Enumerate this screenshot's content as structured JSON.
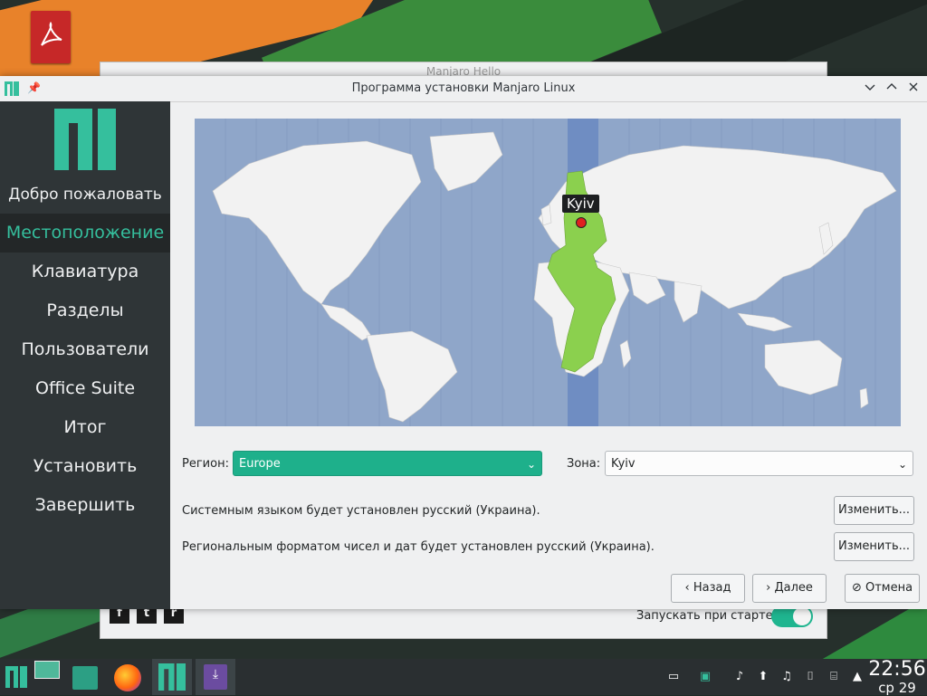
{
  "background_window": {
    "title": "Manjaro Hello",
    "autostart_label": "Запускать при старте",
    "social": [
      "f",
      "t",
      "r"
    ]
  },
  "window": {
    "title": "Программа установки Manjaro Linux"
  },
  "sidebar": {
    "items": [
      {
        "label": "Добро пожаловать"
      },
      {
        "label": "Местоположение"
      },
      {
        "label": "Клавиатура"
      },
      {
        "label": "Разделы"
      },
      {
        "label": "Пользователи"
      },
      {
        "label": "Office Suite"
      },
      {
        "label": "Итог"
      },
      {
        "label": "Установить"
      },
      {
        "label": "Завершить"
      }
    ],
    "active_index": 1
  },
  "map": {
    "selected_city": "Kyiv"
  },
  "location": {
    "region_label": "Регион:",
    "region_value": "Europe",
    "zone_label": "Зона:",
    "zone_value": "Kyiv"
  },
  "info": {
    "language_text": "Системным языком будет установлен русский (Украина).",
    "format_text": "Региональным форматом чисел и дат будет установлен русский (Украина).",
    "change_label": "Изменить..."
  },
  "nav": {
    "back_label": "Назад",
    "next_label": "Далее",
    "cancel_label": "Отмена"
  },
  "taskbar": {
    "time": "22:56",
    "date": "ср 29"
  },
  "colors": {
    "accent": "#1eb08b",
    "sidebar_bg": "#2f3537",
    "active_text": "#35bf9d"
  }
}
